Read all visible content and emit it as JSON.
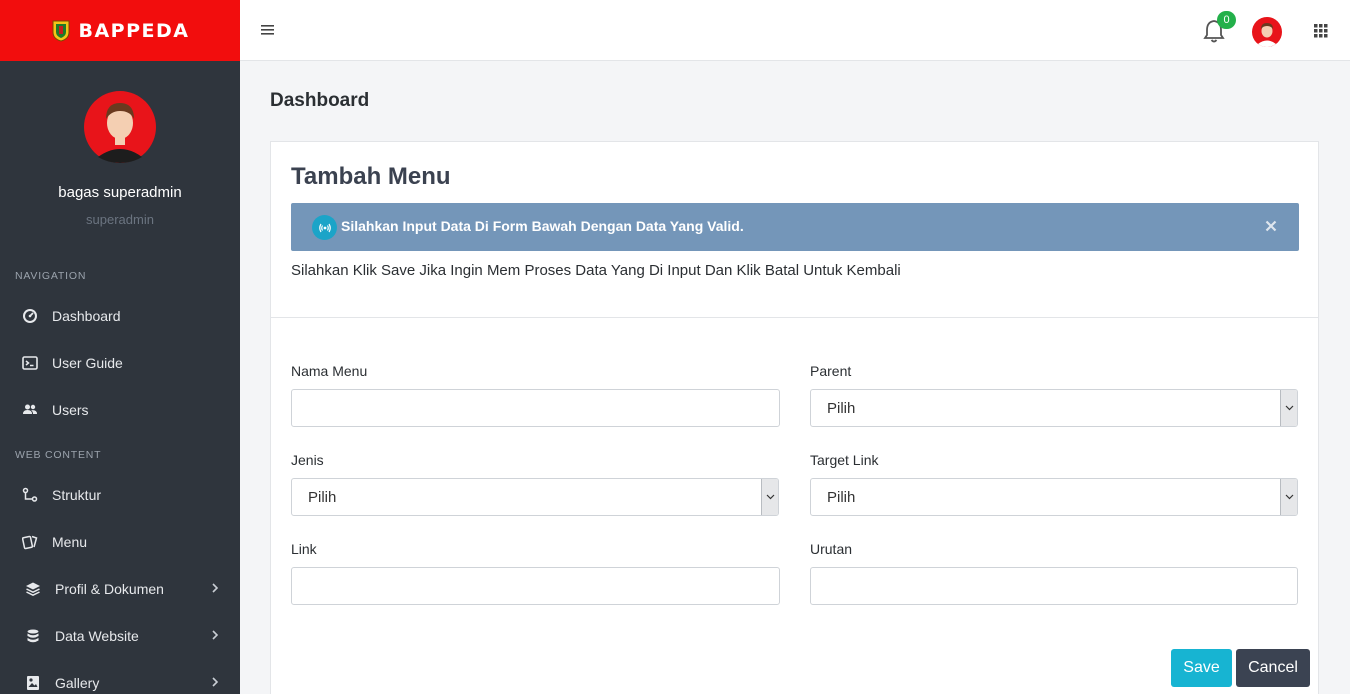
{
  "brand": {
    "name": "BAPPEDA"
  },
  "user": {
    "name": "bagas superadmin",
    "role": "superadmin"
  },
  "nav": {
    "section1": "NAVIGATION",
    "section2": "WEB CONTENT",
    "items": [
      {
        "label": "Dashboard",
        "icon": "dashboard-icon"
      },
      {
        "label": "User Guide",
        "icon": "terminal-icon"
      },
      {
        "label": "Users",
        "icon": "users-icon"
      },
      {
        "label": "Struktur",
        "icon": "tree-icon"
      },
      {
        "label": "Menu",
        "icon": "menu-cards-icon"
      },
      {
        "label": "Profil & Dokumen",
        "icon": "layers-icon",
        "has_children": true
      },
      {
        "label": "Data Website",
        "icon": "database-icon",
        "has_children": true
      },
      {
        "label": "Gallery",
        "icon": "image-icon",
        "has_children": true
      }
    ]
  },
  "topbar": {
    "notification_count": "0"
  },
  "page": {
    "title": "Dashboard"
  },
  "card": {
    "title": "Tambah Menu",
    "alert": "Silahkan Input Data Di Form Bawah Dengan Data Yang Valid.",
    "help": "Silahkan Klik Save Jika Ingin Mem Proses Data Yang Di Input Dan Klik Batal Untuk Kembali"
  },
  "form": {
    "nama_menu": {
      "label": "Nama Menu",
      "value": ""
    },
    "parent": {
      "label": "Parent",
      "value": "Pilih"
    },
    "jenis": {
      "label": "Jenis",
      "value": "Pilih"
    },
    "target_link": {
      "label": "Target Link",
      "value": "Pilih"
    },
    "link": {
      "label": "Link",
      "value": ""
    },
    "urutan": {
      "label": "Urutan",
      "value": ""
    }
  },
  "buttons": {
    "save": "Save",
    "cancel": "Cancel"
  },
  "colors": {
    "brand": "#f20d0d",
    "sidebar": "#2f353d",
    "alert": "#7496b9",
    "save": "#17b4d2",
    "cancel": "#3b4352",
    "badge": "#23b04a"
  }
}
